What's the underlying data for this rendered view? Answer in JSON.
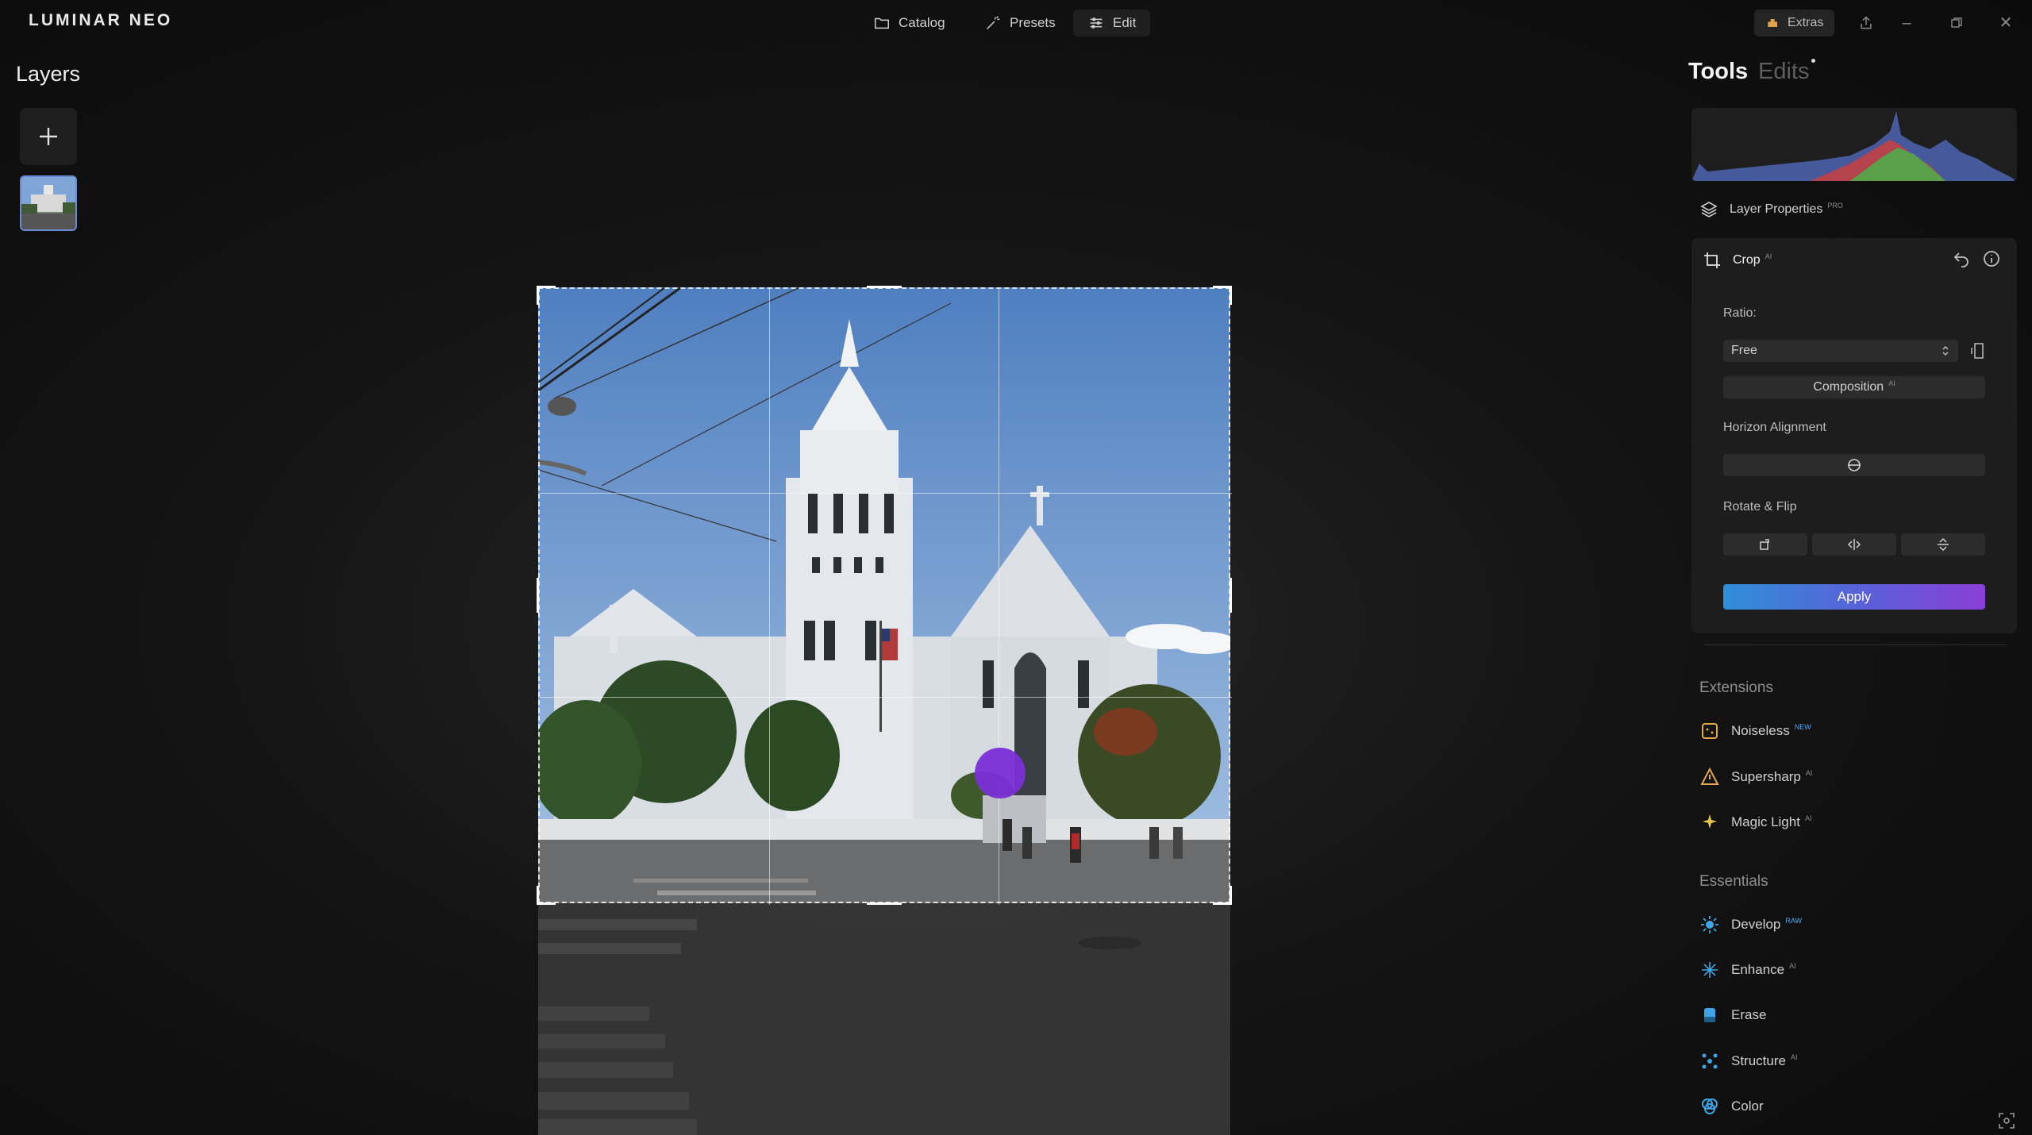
{
  "app": {
    "logo": "LUMINAR NEO"
  },
  "nav": {
    "catalog": "Catalog",
    "presets": "Presets",
    "edit": "Edit",
    "extras": "Extras"
  },
  "layers": {
    "title": "Layers"
  },
  "tools_panel": {
    "tab_tools": "Tools",
    "tab_edits": "Edits",
    "layer_properties": {
      "label": "Layer Properties",
      "badge": "PRO"
    },
    "crop": {
      "title": "Crop",
      "badge": "AI",
      "ratio_label": "Ratio:",
      "ratio_value": "Free",
      "composition_button": "Composition",
      "composition_badge": "AI",
      "horizon_label": "Horizon Alignment",
      "rotate_flip_label": "Rotate & Flip",
      "apply_button": "Apply"
    },
    "extensions": {
      "title": "Extensions",
      "items": [
        {
          "label": "Noiseless",
          "badge": "NEW"
        },
        {
          "label": "Supersharp",
          "badge": "AI"
        },
        {
          "label": "Magic Light",
          "badge": "AI"
        }
      ]
    },
    "essentials": {
      "title": "Essentials",
      "items": [
        {
          "label": "Develop",
          "badge": "RAW"
        },
        {
          "label": "Enhance",
          "badge": "AI"
        },
        {
          "label": "Erase",
          "badge": ""
        },
        {
          "label": "Structure",
          "badge": "AI"
        },
        {
          "label": "Color",
          "badge": ""
        }
      ]
    }
  },
  "colors": {
    "accent_purple": "#7a2fd6",
    "apply_start": "#2f8fd8",
    "apply_end": "#8a3fd6"
  }
}
